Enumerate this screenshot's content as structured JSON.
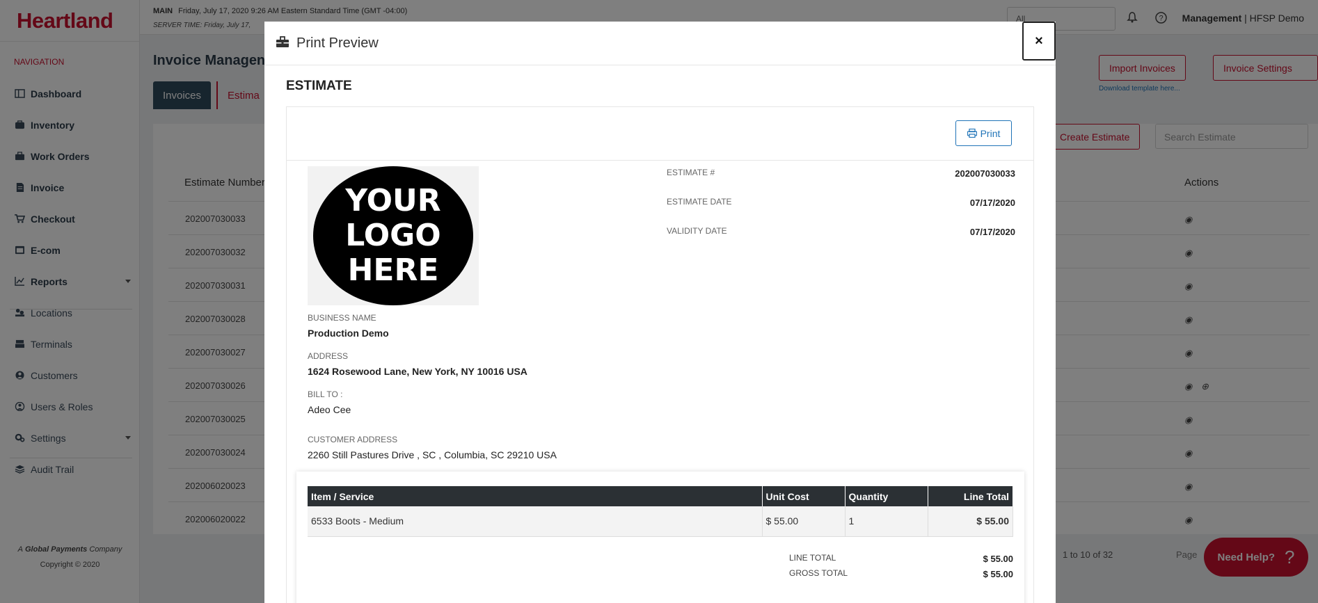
{
  "brand": "Heartland",
  "sidebar": {
    "heading": "NAVIGATION",
    "items": [
      {
        "label": "Dashboard",
        "icon": "dashboard-icon"
      },
      {
        "label": "Inventory",
        "icon": "inventory-icon"
      },
      {
        "label": "Work Orders",
        "icon": "work-orders-icon"
      },
      {
        "label": "Invoice",
        "icon": "invoice-icon"
      },
      {
        "label": "Checkout",
        "icon": "cart-icon"
      },
      {
        "label": "E-com",
        "icon": "ecom-icon"
      },
      {
        "label": "Reports",
        "icon": "chart-icon"
      },
      {
        "label": "Locations",
        "icon": "locations-icon"
      },
      {
        "label": "Terminals",
        "icon": "terminal-icon"
      },
      {
        "label": "Customers",
        "icon": "user-icon"
      },
      {
        "label": "Users & Roles",
        "icon": "users-icon"
      },
      {
        "label": "Settings",
        "icon": "gear-icon"
      },
      {
        "label": "Audit Trail",
        "icon": "layers-icon"
      }
    ],
    "footer_prefix": "A",
    "footer_company": "Global Payments",
    "footer_suffix": "Company",
    "copyright": "Copyright © 2020"
  },
  "topbar": {
    "main_label": "MAIN",
    "datetime": "Friday, July 17, 2020 9:26 AM Eastern Standard Time (GMT -04:00)",
    "server_time": "SERVER TIME: Friday, July 17,",
    "location_select": "All",
    "user_role": "Management",
    "user_name": "HFSP Demo"
  },
  "page": {
    "title": "Invoice Managen",
    "tab_invoices": "Invoices",
    "tab_estimates": "Estima",
    "import_btn": "Import Invoices",
    "settings_btn": "Invoice Settings",
    "download_link": "Download template here...",
    "create_btn": "Create Estimate",
    "search_placeholder": "Search Estimate",
    "col_estimate_number": "Estimate Number",
    "col_actions": "Actions",
    "rows": [
      "202007030033",
      "202007030032",
      "202007030031",
      "202007030028",
      "202007030027",
      "202007030026",
      "202007030025",
      "202007030024",
      "202006020023",
      "202006020022"
    ],
    "pager_text": "1 to 10 of 32",
    "pager_page": "Page",
    "need_help": "Need Help?"
  },
  "modal": {
    "title": "Print Preview",
    "close": "×",
    "heading": "ESTIMATE",
    "print_btn": "Print",
    "logo_lines": [
      "YOUR",
      "LOGO",
      "HERE"
    ],
    "meta": [
      {
        "label": "ESTIMATE #",
        "value": "202007030033"
      },
      {
        "label": "ESTIMATE DATE",
        "value": "07/17/2020"
      },
      {
        "label": "VALIDITY DATE",
        "value": "07/17/2020"
      }
    ],
    "business_name_label": "BUSINESS NAME",
    "business_name": "Production Demo",
    "address_label": "ADDRESS",
    "address": "1624 Rosewood Lane, New York, NY 10016 USA",
    "bill_to_label": "BILL TO :",
    "bill_to": "Adeo Cee",
    "customer_address_label": "CUSTOMER ADDRESS",
    "customer_address": "2260 Still Pastures Drive , SC , Columbia, SC 29210 USA",
    "table_headers": [
      "Item / Service",
      "Unit Cost",
      "Quantity",
      "Line Total"
    ],
    "table_rows": [
      {
        "item": "6533 Boots - Medium",
        "unit_cost": "$ 55.00",
        "quantity": "1",
        "line_total": "$ 55.00"
      }
    ],
    "line_total_label": "LINE TOTAL",
    "line_total": "$ 55.00",
    "gross_total_label": "GROSS TOTAL",
    "gross_total": "$ 55.00"
  }
}
